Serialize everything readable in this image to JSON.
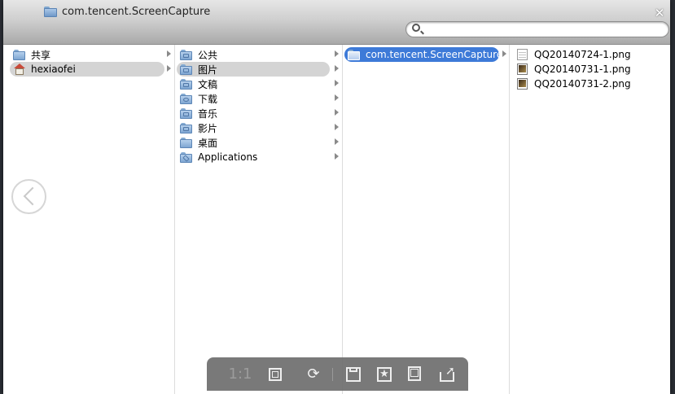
{
  "window": {
    "title": "com.tencent.ScreenCapture",
    "close_glyph": "✕"
  },
  "search": {
    "value": "",
    "placeholder": ""
  },
  "columns": {
    "col1": [
      {
        "label": "共享",
        "icon": "shared-folder-icon",
        "has_children": true,
        "selected": false
      },
      {
        "label": "hexiaofei",
        "icon": "home-icon",
        "has_children": true,
        "selected": true
      }
    ],
    "col2": [
      {
        "label": "公共",
        "icon": "public-folder-icon",
        "has_children": true,
        "selected": false
      },
      {
        "label": "图片",
        "icon": "pictures-folder-icon",
        "has_children": true,
        "selected": true
      },
      {
        "label": "文稿",
        "icon": "documents-folder-icon",
        "has_children": true,
        "selected": false
      },
      {
        "label": "下载",
        "icon": "downloads-folder-icon",
        "has_children": true,
        "selected": false
      },
      {
        "label": "音乐",
        "icon": "music-folder-icon",
        "has_children": true,
        "selected": false
      },
      {
        "label": "影片",
        "icon": "movies-folder-icon",
        "has_children": true,
        "selected": false
      },
      {
        "label": "桌面",
        "icon": "desktop-folder-icon",
        "has_children": true,
        "selected": false
      },
      {
        "label": "Applications",
        "icon": "applications-folder-icon",
        "has_children": true,
        "selected": false
      }
    ],
    "col3": [
      {
        "label": "com.tencent.ScreenCapture",
        "icon": "folder-icon",
        "has_children": true,
        "selected": true
      }
    ],
    "col4": [
      {
        "label": "QQ20140724-1.png",
        "icon": "blank-file-icon"
      },
      {
        "label": "QQ20140731-1.png",
        "icon": "image-file-icon"
      },
      {
        "label": "QQ20140731-2.png",
        "icon": "image-file-icon"
      }
    ]
  },
  "toolbar": {
    "actual_size_label": "1:1",
    "icons": [
      "fit-icon",
      "rotate-icon",
      "save-icon",
      "favorite-icon",
      "view-icon",
      "share-icon"
    ]
  },
  "colors": {
    "selection_blue": "#3d7ad8",
    "selection_gray": "#d4d4d4",
    "toolbar_bg": "#6e6e6e"
  }
}
